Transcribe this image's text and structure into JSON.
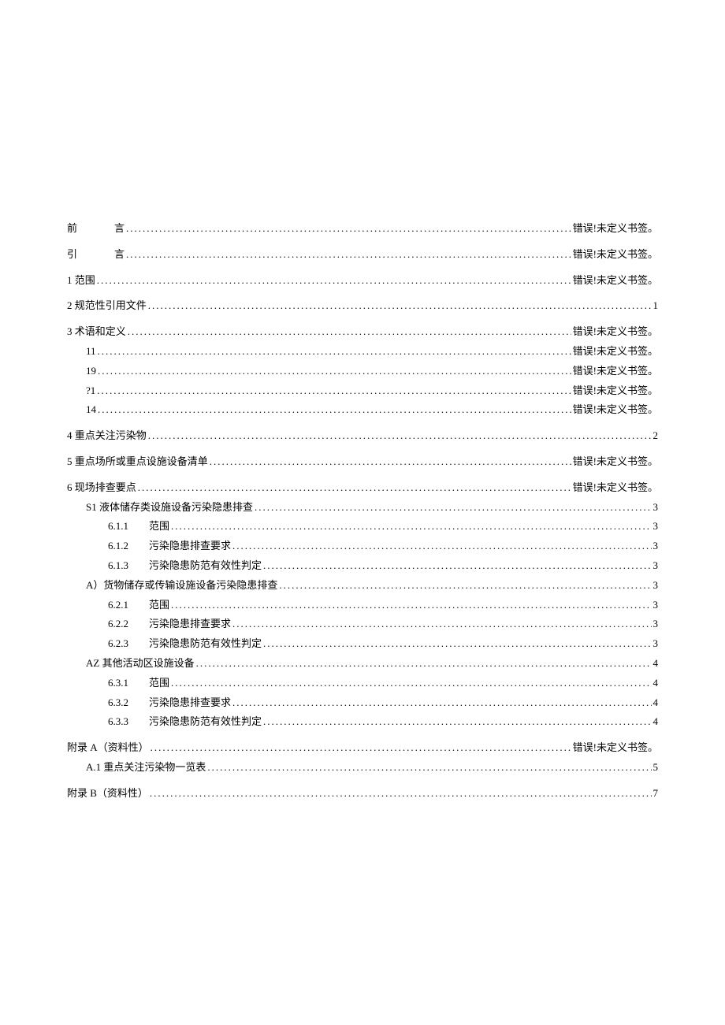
{
  "error_bookmark": "错误!未定义书签。",
  "entries": [
    {
      "level": 0,
      "spaced": true,
      "label_a": "前",
      "label_b": "言",
      "page_type": "err"
    },
    {
      "level": 0,
      "spaced": true,
      "label_a": "引",
      "label_b": "言",
      "page_type": "err"
    },
    {
      "level": 0,
      "label": "1 范围",
      "page_type": "err"
    },
    {
      "level": 0,
      "label": "2 规范性引用文件",
      "page": "1"
    },
    {
      "level": 0,
      "label": "3 术语和定义",
      "page_type": "err",
      "tight_after": true
    },
    {
      "level": 1,
      "label": "11",
      "page_type": "err"
    },
    {
      "level": 1,
      "label": "19",
      "page_type": "err"
    },
    {
      "level": 1,
      "label": "?1",
      "page_type": "err"
    },
    {
      "level": 1,
      "label": "14",
      "page_type": "err"
    },
    {
      "level": 0,
      "label": "4 重点关注污染物",
      "page": "2",
      "space_before": true
    },
    {
      "level": 0,
      "label": "5 重点场所或重点设施设备清单",
      "page_type": "err"
    },
    {
      "level": 0,
      "label": "6 现场排查要点",
      "page_type": "err",
      "tight_after": true
    },
    {
      "level": 1,
      "label": "S1 液体储存类设施设备污染隐患排查",
      "page": "3"
    },
    {
      "level": 2,
      "num": "6.1.1",
      "label": "范围",
      "page": "3"
    },
    {
      "level": 2,
      "num": "6.1.2",
      "label": "污染隐患排查要求",
      "page": "3"
    },
    {
      "level": 2,
      "num": "6.1.3",
      "label": "污染隐患防范有效性判定",
      "page": "3"
    },
    {
      "level": 1,
      "label": "A）货物储存或传输设施设备污染隐患排查",
      "page": "3"
    },
    {
      "level": 2,
      "num": "6.2.1",
      "label": "范围",
      "page": "3"
    },
    {
      "level": 2,
      "num": "6.2.2",
      "label": "污染隐患排查要求",
      "page": "3"
    },
    {
      "level": 2,
      "num": "6.2.3",
      "label": "污染隐患防范有效性判定",
      "page": "3"
    },
    {
      "level": 1,
      "label": "AZ 其他活动区设施设备",
      "page": "4"
    },
    {
      "level": 2,
      "num": "6.3.1",
      "label": "范围",
      "page": "4"
    },
    {
      "level": 2,
      "num": "6.3.2",
      "label": "污染隐患排查要求",
      "page": "4"
    },
    {
      "level": 2,
      "num": "6.3.3",
      "label": "污染隐患防范有效性判定",
      "page": "4"
    },
    {
      "level": 0,
      "label": "附录 A（资料性）",
      "page_type": "err",
      "tight_after": true,
      "space_before": true
    },
    {
      "level": 1,
      "label": "A.1 重点关注污染物一览表",
      "page": "5"
    },
    {
      "level": 0,
      "label": "附录 B（资料性）",
      "page": "7",
      "space_before": true
    }
  ]
}
